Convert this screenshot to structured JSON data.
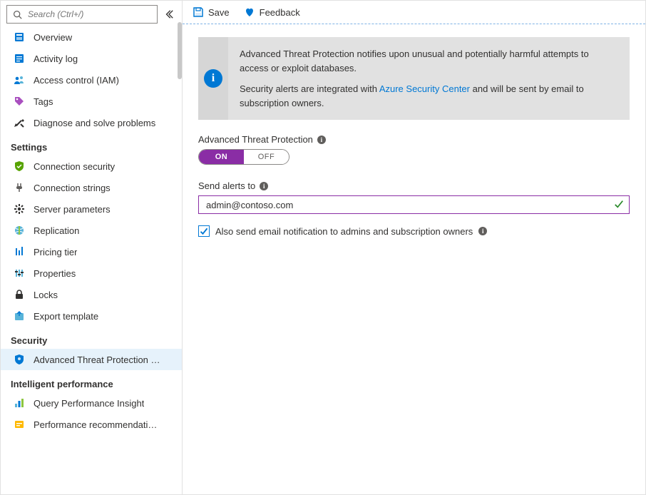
{
  "search": {
    "placeholder": "Search (Ctrl+/)"
  },
  "sidebar": {
    "groups": [
      {
        "header": null,
        "items": [
          {
            "id": "overview",
            "label": "Overview",
            "icon": "overview"
          },
          {
            "id": "activity",
            "label": "Activity log",
            "icon": "activity"
          },
          {
            "id": "iam",
            "label": "Access control (IAM)",
            "icon": "iam"
          },
          {
            "id": "tags",
            "label": "Tags",
            "icon": "tags"
          },
          {
            "id": "diagnose",
            "label": "Diagnose and solve problems",
            "icon": "diagnose"
          }
        ]
      },
      {
        "header": "Settings",
        "items": [
          {
            "id": "connsec",
            "label": "Connection security",
            "icon": "shield-green"
          },
          {
            "id": "connstr",
            "label": "Connection strings",
            "icon": "plug"
          },
          {
            "id": "params",
            "label": "Server parameters",
            "icon": "gear"
          },
          {
            "id": "repl",
            "label": "Replication",
            "icon": "globe"
          },
          {
            "id": "tier",
            "label": "Pricing tier",
            "icon": "pricing"
          },
          {
            "id": "props",
            "label": "Properties",
            "icon": "properties"
          },
          {
            "id": "locks",
            "label": "Locks",
            "icon": "lock"
          },
          {
            "id": "export",
            "label": "Export template",
            "icon": "export"
          }
        ]
      },
      {
        "header": "Security",
        "items": [
          {
            "id": "atp",
            "label": "Advanced Threat Protection …",
            "icon": "shield-blue",
            "selected": true
          }
        ]
      },
      {
        "header": "Intelligent performance",
        "items": [
          {
            "id": "qpi",
            "label": "Query Performance Insight",
            "icon": "chart"
          },
          {
            "id": "perfrec",
            "label": "Performance recommendati…",
            "icon": "recommend"
          }
        ]
      }
    ]
  },
  "toolbar": {
    "save": "Save",
    "feedback": "Feedback"
  },
  "banner": {
    "line1": "Advanced Threat Protection notifies upon unusual and potentially harmful attempts to access or exploit databases.",
    "line2a": "Security alerts are integrated with ",
    "link": "Azure Security Center",
    "line2b": " and will be sent by email to subscription owners."
  },
  "form": {
    "atp_label": "Advanced Threat Protection",
    "toggle_on": "ON",
    "toggle_off": "OFF",
    "toggle_value": "ON",
    "send_alerts_label": "Send alerts to",
    "send_alerts_value": "admin@contoso.com",
    "also_send_label": "Also send email notification to admins and subscription owners",
    "also_send_checked": true
  }
}
